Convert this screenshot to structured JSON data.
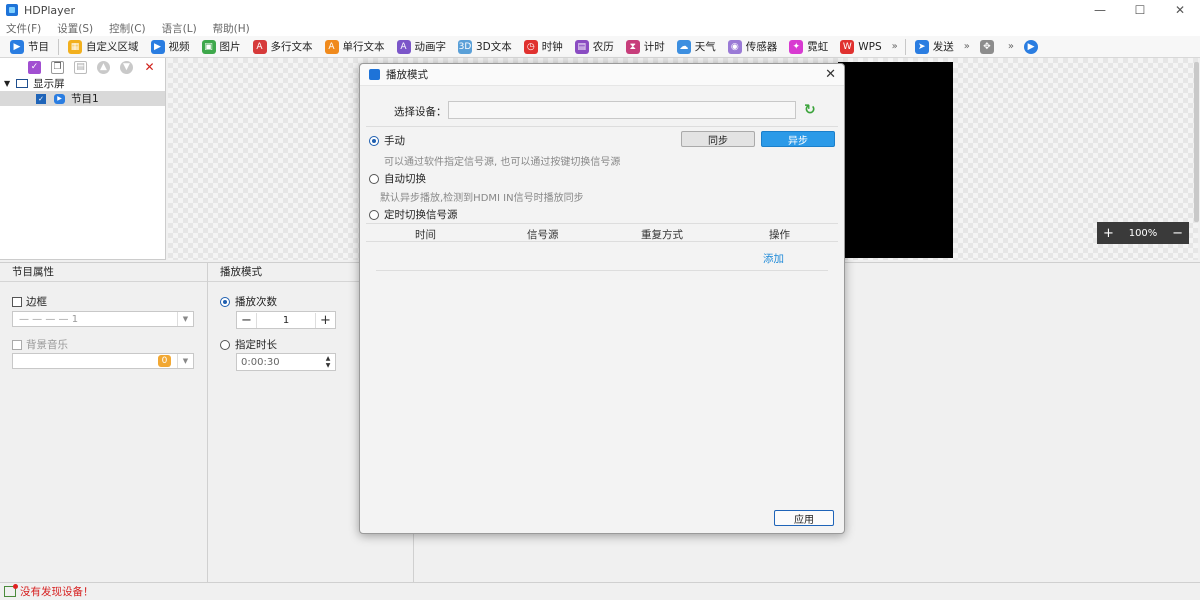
{
  "app": {
    "title": "HDPlayer"
  },
  "window_controls": {
    "minimize": "—",
    "maximize": "☐",
    "close": "✕"
  },
  "menu": [
    "文件(F)",
    "设置(S)",
    "控制(C)",
    "语言(L)",
    "帮助(H)"
  ],
  "toolbar": {
    "program": "节目",
    "items": [
      {
        "label": "自定义区域",
        "icon": "grid-icon",
        "color": "#f2b01e"
      },
      {
        "label": "视频",
        "icon": "play-icon",
        "color": "#2a7de1"
      },
      {
        "label": "图片",
        "icon": "image-icon",
        "color": "#3ea84b"
      },
      {
        "label": "多行文本",
        "icon": "multiline-text-icon",
        "color": "#d63a3a"
      },
      {
        "label": "单行文本",
        "icon": "single-text-icon",
        "color": "#f08a1c"
      },
      {
        "label": "动画字",
        "icon": "animated-text-icon",
        "color": "#7b56c9"
      },
      {
        "label": "3D文本",
        "icon": "3d-text-icon",
        "color": "#5aa0d8"
      },
      {
        "label": "时钟",
        "icon": "clock-icon",
        "color": "#e0312f"
      },
      {
        "label": "农历",
        "icon": "lunar-calendar-icon",
        "color": "#8a4cc2"
      },
      {
        "label": "计时",
        "icon": "hourglass-icon",
        "color": "#c73e7b"
      },
      {
        "label": "天气",
        "icon": "weather-icon",
        "color": "#3d8fe0"
      },
      {
        "label": "传感器",
        "icon": "sensor-icon",
        "color": "#9a7ad6"
      },
      {
        "label": "霓虹",
        "icon": "neon-icon",
        "color": "#d83ad1"
      },
      {
        "label": "WPS",
        "icon": "wps-icon",
        "color": "#e0312f"
      }
    ],
    "more": "»",
    "send": "发送"
  },
  "tree": {
    "screen": "显示屏",
    "program": "节目1"
  },
  "canvas": {
    "zoom": "100%",
    "zoom_in": "+",
    "zoom_out": "−"
  },
  "program_props": {
    "header": "节目属性",
    "border_label": "边框",
    "border_value": "— — — —   1",
    "bg_music_label": "背景音乐",
    "bg_music_count": "0"
  },
  "play_mode": {
    "header": "播放模式",
    "play_count_label": "播放次数",
    "play_count_value": "1",
    "duration_label": "指定时长",
    "duration_value": "0:00:30"
  },
  "status": {
    "text": "没有发现设备！"
  },
  "dialog": {
    "title": "播放模式",
    "device_label": "选择设备：",
    "device_value": "",
    "manual_label": "手动",
    "sync_btn": "同步",
    "async_btn": "异步",
    "manual_desc": "可以通过软件指定信号源, 也可以通过按键切换信号源",
    "auto_label": "自动切换",
    "auto_desc": "默认异步播放,检测到HDMI IN信号时播放同步",
    "timed_label": "定时切换信号源",
    "table_headers": [
      "时间",
      "信号源",
      "重复方式",
      "操作"
    ],
    "add_link": "添加",
    "apply_btn": "应用"
  }
}
